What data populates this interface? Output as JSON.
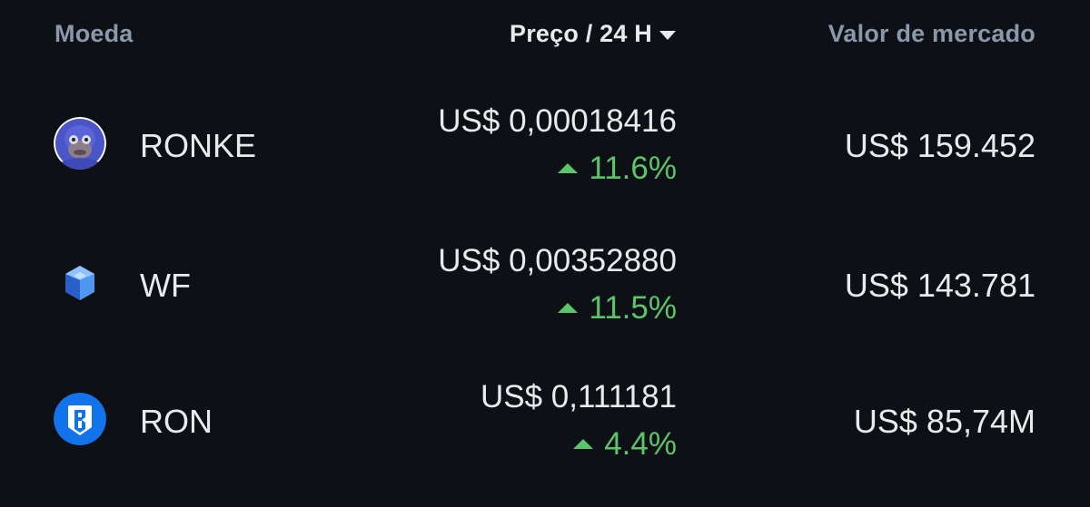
{
  "header": {
    "coin_label": "Moeda",
    "price_label": "Preço / 24 H",
    "market_cap_label": "Valor de mercado"
  },
  "coins": [
    {
      "symbol": "RONKE",
      "price": "US$ 0,00018416",
      "change": "11.6%",
      "market_cap": "US$ 159.452",
      "icon": "ape-avatar-icon"
    },
    {
      "symbol": "WF",
      "price": "US$ 0,00352880",
      "change": "11.5%",
      "market_cap": "US$ 143.781",
      "icon": "blue-gem-icon"
    },
    {
      "symbol": "RON",
      "price": "US$ 0,111181",
      "change": "4.4%",
      "market_cap": "US$ 85,74M",
      "icon": "ronin-shield-icon"
    }
  ],
  "colors": {
    "background": "#0d1014",
    "header_muted": "#8b98ab",
    "text": "#e8eaed",
    "positive": "#5cc46a"
  }
}
